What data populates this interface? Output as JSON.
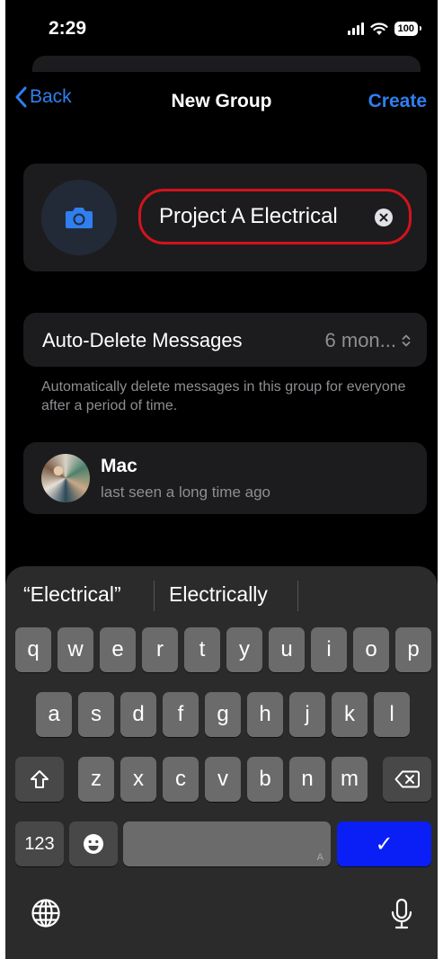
{
  "status_bar": {
    "time": "2:29",
    "battery": "100"
  },
  "nav": {
    "back_label": "Back",
    "title": "New Group",
    "create_label": "Create"
  },
  "group": {
    "name_value": "Project A Electrical"
  },
  "auto_delete": {
    "label": "Auto-Delete Messages",
    "value": "6 mon...",
    "footer": "Automatically delete messages in this group for everyone after a period of time."
  },
  "member": {
    "name": "Mac",
    "status": "last seen a long time ago"
  },
  "keyboard": {
    "suggestions": [
      "“Electrical”",
      "Electrically"
    ],
    "row1": [
      "q",
      "w",
      "e",
      "r",
      "t",
      "y",
      "u",
      "i",
      "o",
      "p"
    ],
    "row2": [
      "a",
      "s",
      "d",
      "f",
      "g",
      "h",
      "j",
      "k",
      "l"
    ],
    "row3": [
      "z",
      "x",
      "c",
      "v",
      "b",
      "n",
      "m"
    ],
    "numbers_label": "123",
    "space_hint": "A",
    "done_symbol": "✓"
  },
  "colors": {
    "accent": "#2f7ff0",
    "highlight": "#d3131c",
    "done_key": "#0a1ff5"
  },
  "icons": [
    "chevron-left-icon",
    "camera-icon",
    "clear-icon",
    "updown-chevron-icon",
    "shift-icon",
    "backspace-icon",
    "emoji-icon",
    "globe-icon",
    "microphone-icon"
  ]
}
